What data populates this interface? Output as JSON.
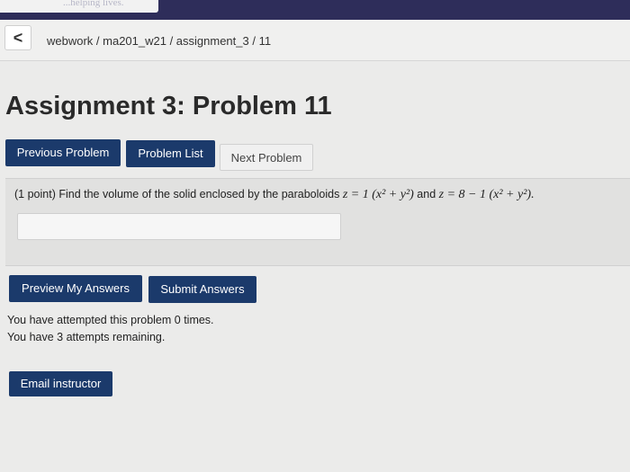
{
  "browser": {
    "tab_text": "...helping lives."
  },
  "breadcrumb": {
    "back_icon": "chevron-left-icon",
    "back_glyph": "<",
    "path": "webwork / ma201_w21 / assignment_3 / 11"
  },
  "page_title": "Assignment 3: Problem 11",
  "nav": {
    "previous": "Previous Problem",
    "list": "Problem List",
    "next": "Next Problem"
  },
  "problem": {
    "intro": "(1 point) Find the volume of the solid enclosed by the paraboloids",
    "eq1": "z = 1 (x² + y²)",
    "connector": "and",
    "eq2": "z = 8 − 1 (x² + y²).",
    "answer_value": ""
  },
  "actions": {
    "preview": "Preview My Answers",
    "submit": "Submit Answers"
  },
  "status": {
    "attempted": "You have attempted this problem 0 times.",
    "remaining": "You have 3 attempts remaining."
  },
  "email_button": "Email instructor",
  "colors": {
    "header_bg": "#2e2d5a",
    "primary_button": "#1b3a6b",
    "page_bg": "#ebebea"
  }
}
